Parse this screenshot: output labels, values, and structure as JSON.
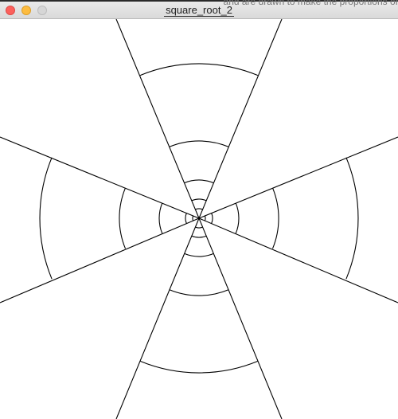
{
  "window": {
    "title": "square_root_2",
    "behind_text": "and are drawn to make the proportions of",
    "footer_text": "...",
    "controls": [
      "close",
      "minimize",
      "zoom"
    ],
    "colors": {
      "close": "#fc605c",
      "minimize": "#fdbc40",
      "zoom": "#d6d6d6"
    }
  },
  "drawing": {
    "type": "radial-spokes-with-arcs",
    "stroke": "#000000",
    "spoke_count": 8,
    "arc_ring_count": 5
  }
}
